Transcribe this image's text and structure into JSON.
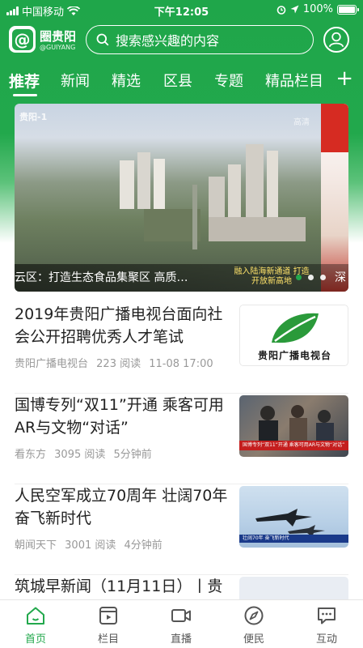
{
  "status_bar": {
    "carrier": "中国移动",
    "time": "下午12:05",
    "battery": "100%",
    "battery_level": 1.0
  },
  "header": {
    "brand_name": "圈贵阳",
    "brand_sub": "@GUIYANG",
    "logo_glyph": "@",
    "search_placeholder": "搜索感兴趣的内容"
  },
  "tabs": [
    {
      "label": "推荐",
      "active": true
    },
    {
      "label": "新闻"
    },
    {
      "label": "精选"
    },
    {
      "label": "区县"
    },
    {
      "label": "专题"
    },
    {
      "label": "精品栏目"
    }
  ],
  "tab_add_label": "+",
  "banner": {
    "watermark": "贵阳-1",
    "hd_label": "高清",
    "caption": "云区：打造生态食品集聚区 高质…",
    "overlay_text": "融入陆海新通道 打造开放新高地",
    "right_text": "深",
    "dots": 3,
    "active_dot": 0
  },
  "news": [
    {
      "title": "2019年贵阳广播电视台面向社会公开招聘优秀人才笔试",
      "source": "贵阳广播电视台",
      "reads": "223 阅读",
      "time": "11-08 17:00",
      "thumb_text": "贵阳广播电视台"
    },
    {
      "title": "国博专列“双11”开通 乘客可用AR与文物“对话”",
      "source": "看东方",
      "reads": "3095 阅读",
      "time": "5分钟前",
      "thumb_text": "国博专列“双11”开通 乘客可用AR与文物“对话”"
    },
    {
      "title": "人民空军成立70周年 壮阔70年 奋飞新时代",
      "source": "朝闻天下",
      "reads": "3001 阅读",
      "time": "4分钟前",
      "thumb_text": "壮阔70年 奋飞新时代"
    },
    {
      "title": "筑城早新闻（11月11日）丨贵"
    }
  ],
  "bottom_nav": [
    {
      "label": "首页",
      "icon": "home-icon",
      "active": true
    },
    {
      "label": "栏目",
      "icon": "column-icon"
    },
    {
      "label": "直播",
      "icon": "video-camera-icon"
    },
    {
      "label": "便民",
      "icon": "compass-icon"
    },
    {
      "label": "互动",
      "icon": "chat-icon"
    }
  ],
  "colors": {
    "brand_green": "#22a84c",
    "text_dark": "#222222",
    "meta_gray": "#999999"
  }
}
